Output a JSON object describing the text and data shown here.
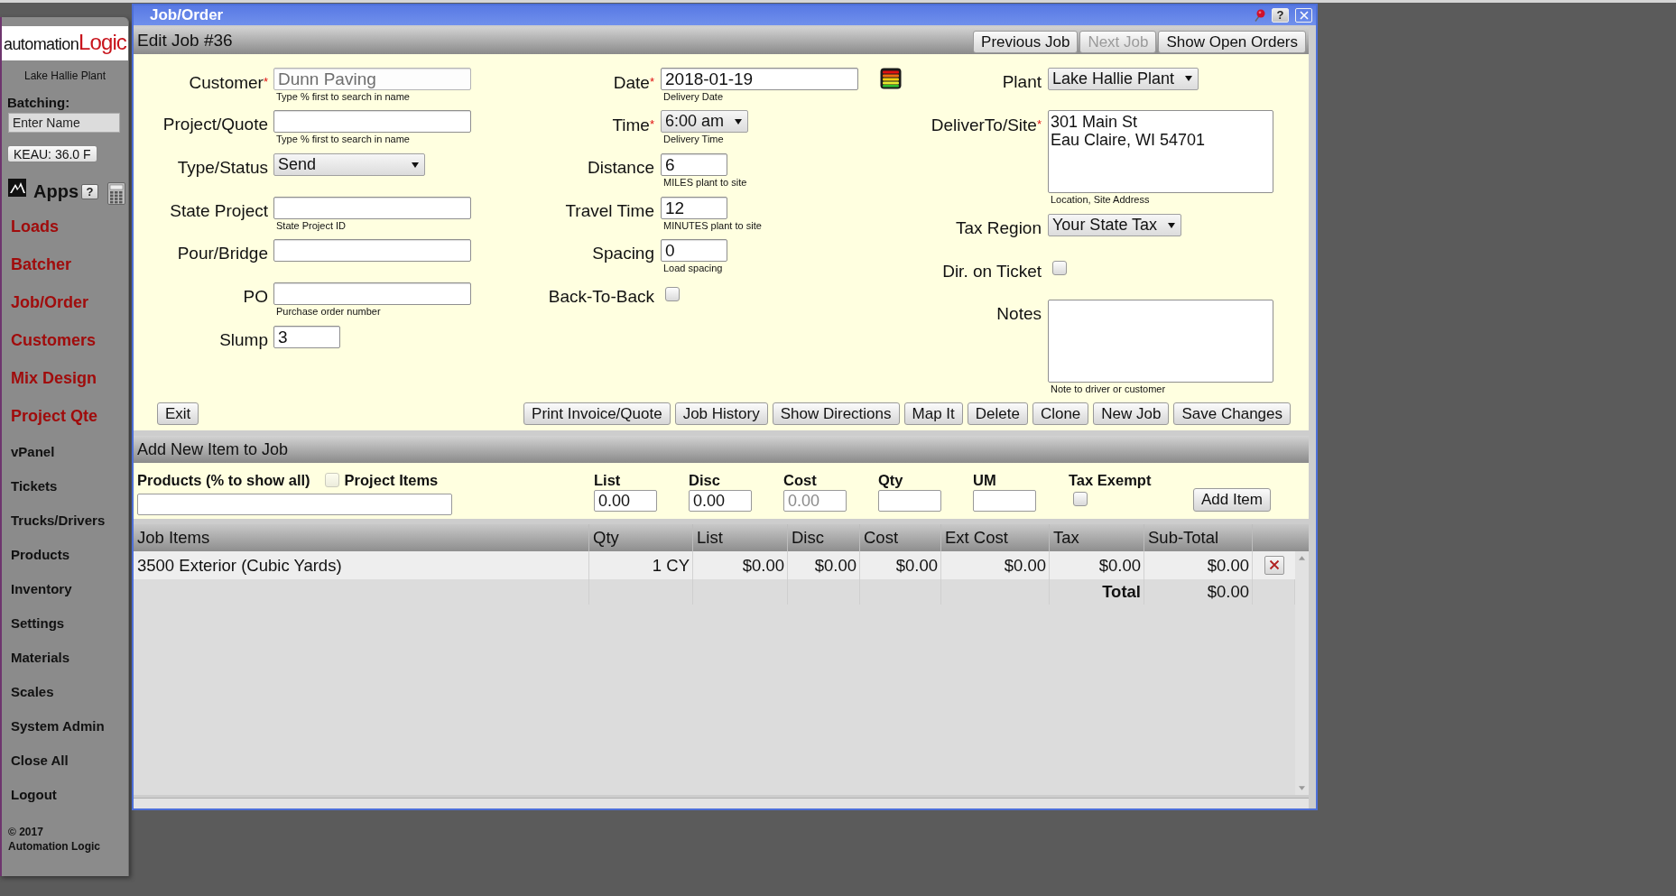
{
  "sidebar": {
    "logo": {
      "prefix": "automation",
      "suffix": "Logic"
    },
    "plant": "Lake Hallie Plant",
    "batching": {
      "label": "Batching:",
      "placeholder": "Enter Name"
    },
    "weather": "KEAU: 36.0 F",
    "apps": {
      "label": "Apps",
      "help": "?"
    },
    "items": [
      {
        "label": "Loads",
        "kind": "app"
      },
      {
        "label": "Batcher",
        "kind": "app"
      },
      {
        "label": "Job/Order",
        "kind": "app"
      },
      {
        "label": "Customers",
        "kind": "app"
      },
      {
        "label": "Mix Design",
        "kind": "app"
      },
      {
        "label": "Project Qte",
        "kind": "app"
      },
      {
        "label": "vPanel",
        "kind": "menu"
      },
      {
        "label": "Tickets",
        "kind": "menu"
      },
      {
        "label": "Trucks/Drivers",
        "kind": "menu"
      },
      {
        "label": "Products",
        "kind": "menu"
      },
      {
        "label": "Inventory",
        "kind": "menu"
      },
      {
        "label": "Settings",
        "kind": "menu"
      },
      {
        "label": "Materials",
        "kind": "menu"
      },
      {
        "label": "Scales",
        "kind": "menu"
      },
      {
        "label": "System Admin",
        "kind": "menu"
      },
      {
        "label": "Close All",
        "kind": "menu"
      },
      {
        "label": "Logout",
        "kind": "menu"
      }
    ],
    "copyright": "© 2017",
    "company": "Automation Logic"
  },
  "window": {
    "title": "Job/Order",
    "help": "?"
  },
  "header": {
    "title": "Edit Job #36",
    "buttons": [
      {
        "label": "Previous Job",
        "disabled": false
      },
      {
        "label": "Next Job",
        "disabled": true
      },
      {
        "label": "Show Open Orders",
        "disabled": false
      }
    ]
  },
  "form": {
    "columns": [
      {
        "fields": [
          {
            "label": "Customer",
            "required_mark": "*",
            "kind": "text",
            "value": "Dunn Paving",
            "disabled": true,
            "hint": "Type % first to search in name"
          },
          {
            "label": "Project/Quote",
            "kind": "text",
            "disabled": false,
            "hint": "Type % first to search in name"
          },
          {
            "label": "Type/Status",
            "kind": "select",
            "value": "Send",
            "disabled": false
          },
          {
            "label": "State Project",
            "kind": "text",
            "disabled": false,
            "hint": "State Project ID"
          },
          {
            "label": "Pour/Bridge",
            "kind": "text",
            "disabled": false
          },
          {
            "label": "PO",
            "kind": "text",
            "disabled": false,
            "hint": "Purchase order number"
          },
          {
            "label": "Slump",
            "kind": "number",
            "value": "3",
            "disabled": false
          }
        ]
      },
      {
        "fields": [
          {
            "label": "Date",
            "required_mark": "*",
            "kind": "date",
            "value": "2018-01-19",
            "disabled": false,
            "hint": "Delivery Date"
          },
          {
            "label": "Time",
            "required_mark": "*",
            "kind": "select",
            "value": "6:00 am",
            "disabled": false,
            "hint": "Delivery Time"
          },
          {
            "label": "Distance",
            "kind": "number",
            "value": "6",
            "disabled": false,
            "hint": "MILES plant to site"
          },
          {
            "label": "Travel Time",
            "kind": "number",
            "value": "12",
            "disabled": false,
            "hint": "MINUTES plant to site"
          },
          {
            "label": "Spacing",
            "kind": "number",
            "value": "0",
            "disabled": false,
            "hint": "Load spacing"
          },
          {
            "label": "Back-To-Back",
            "kind": "checkbox",
            "checked": false,
            "disabled": false
          }
        ]
      },
      {
        "fields": [
          {
            "label": "Plant",
            "kind": "select",
            "value": "Lake Hallie Plant",
            "disabled": false
          },
          {
            "label": "DeliverTo/Site",
            "required_mark": "*",
            "kind": "textarea",
            "value": "301 Main St\nEau Claire, WI 54701",
            "disabled": false,
            "hint": "Location, Site Address"
          },
          {
            "label": "Tax Region",
            "kind": "select",
            "value": "Your State Tax",
            "disabled": false
          },
          {
            "label": "Dir. on Ticket",
            "kind": "checkbox",
            "checked": false,
            "disabled": false
          },
          {
            "label": "Notes",
            "kind": "textarea",
            "disabled": false,
            "hint": "Note to driver or customer"
          }
        ]
      }
    ],
    "exit_button": "Exit",
    "buttons": [
      "Print Invoice/Quote",
      "Job History",
      "Show Directions",
      "Map It",
      "Delete",
      "Clone",
      "New Job",
      "Save Changes"
    ]
  },
  "add_item": {
    "title": "Add New Item to Job",
    "products": {
      "label": "Products (% to show all)"
    },
    "project_items": {
      "label": "Project Items",
      "checked": false,
      "disabled": true
    },
    "fields": [
      {
        "label": "List",
        "value": "0.00"
      },
      {
        "label": "Disc",
        "value": "0.00"
      },
      {
        "label": "Cost",
        "placeholder": "0.00"
      },
      {
        "label": "Qty"
      },
      {
        "label": "UM"
      }
    ],
    "tax_exempt": {
      "label": "Tax Exempt",
      "checked": false,
      "disabled": false
    },
    "button": "Add Item"
  },
  "table": {
    "columns": [
      "Job Items",
      "Qty",
      "List",
      "Disc",
      "Cost",
      "Ext Cost",
      "Tax",
      "Sub-Total"
    ],
    "rows": [
      {
        "cells": [
          "3500 Exterior (Cubic Yards)",
          "1 CY",
          "$0.00",
          "$0.00",
          "$0.00",
          "$0.00",
          "$0.00",
          "$0.00"
        ]
      }
    ],
    "total": {
      "label": "Total",
      "value": "$0.00"
    }
  }
}
